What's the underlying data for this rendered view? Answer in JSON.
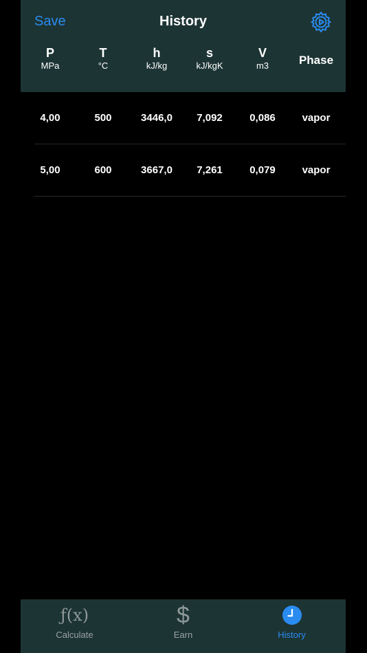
{
  "nav": {
    "save_label": "Save",
    "title": "History"
  },
  "columns": [
    {
      "symbol": "P",
      "unit": "MPa"
    },
    {
      "symbol": "T",
      "unit": "°C"
    },
    {
      "symbol": "h",
      "unit": "kJ/kg"
    },
    {
      "symbol": "s",
      "unit": "kJ/kgK"
    },
    {
      "symbol": "V",
      "unit": "m3"
    },
    {
      "symbol": "Phase",
      "unit": ""
    }
  ],
  "rows": [
    [
      "4,00",
      "500",
      "3446,0",
      "7,092",
      "0,086",
      "vapor"
    ],
    [
      "5,00",
      "600",
      "3667,0",
      "7,261",
      "0,079",
      "vapor"
    ]
  ],
  "tabs": [
    {
      "label": "Calculate",
      "icon": "function-icon",
      "glyph": "ƒ(x)"
    },
    {
      "label": "Earn",
      "icon": "dollar-icon",
      "glyph": "$"
    },
    {
      "label": "History",
      "icon": "clock-icon"
    }
  ],
  "colors": {
    "accent": "#2a8cf0",
    "header_bg": "#1d3434",
    "background": "#000000"
  }
}
